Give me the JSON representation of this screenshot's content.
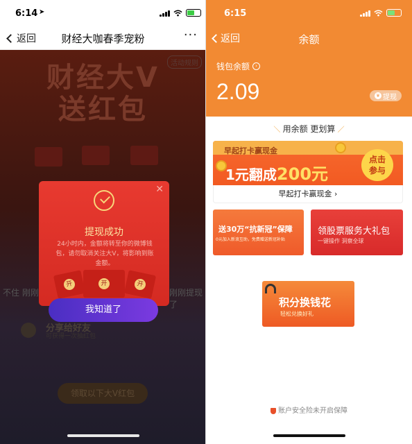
{
  "left": {
    "status": {
      "time": "6:14"
    },
    "nav": {
      "back_label": "返回",
      "title": "财经大咖春季宠粉",
      "more": "···"
    },
    "background": {
      "headline_line1": "财经大V",
      "headline_line2": "送红包",
      "tag": "活动规则",
      "side_left": "不住 刚刚",
      "side_right": "刚刚提现了",
      "share_title": "分享给好友",
      "share_sub": "可获得一次抽红包",
      "pill": "领取以下大V红包"
    },
    "modal": {
      "title": "提现成功",
      "desc": "24小时内，金额将转至你的微博钱包，请勿取消关注大V，将影响到账金额。",
      "envelope_label": "开",
      "ok_button": "我知道了"
    }
  },
  "right": {
    "status": {
      "time": "6:15"
    },
    "nav": {
      "back_label": "返回",
      "title": "余额"
    },
    "balance": {
      "label": "钱包余额",
      "value": "2.09",
      "withdraw": "提现",
      "currency_icon": "¥"
    },
    "slogan": "用余额 更划算",
    "banner1": {
      "top": "早起打卡赢现金",
      "main_prefix": "1元翻成",
      "main_amount": "200元",
      "join_line1": "点击",
      "join_line2": "参与",
      "link_text": "早起打卡赢现金",
      "link_arrow": "›"
    },
    "card2": {
      "title": "送30万“抗新冠”保障",
      "sub": "0元加入新浪互助，免费赠送新冠补贴"
    },
    "card3": {
      "title": "领股票服务大礼包",
      "sub": "一键操作 洞察全球"
    },
    "card4": {
      "title": "积分换钱花",
      "sub": "轻松兑换好礼"
    },
    "security": "账户安全险未开启保障"
  },
  "colors": {
    "orange": "#f28a33",
    "modal_red": "#e83a30",
    "button_purple": "#5a33d0"
  }
}
